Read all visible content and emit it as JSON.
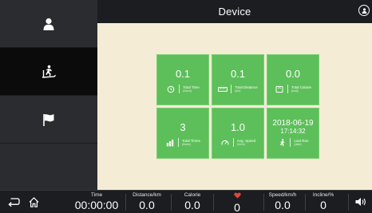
{
  "header": {
    "title": "Device"
  },
  "sidebar": {
    "items": [
      {
        "icon": "user-icon"
      },
      {
        "icon": "treadmill-runner-icon",
        "active": true
      },
      {
        "icon": "flag-icon"
      }
    ]
  },
  "cards": [
    {
      "value": "0.1",
      "icon": "clock-icon",
      "label": "Total Time",
      "unit": "(hours)"
    },
    {
      "value": "0.1",
      "icon": "ruler-icon",
      "label": "Total Distance",
      "unit": "(km)"
    },
    {
      "value": "0.0",
      "icon": "scale-icon",
      "label": "Total Calorie",
      "unit": "(kcal)"
    },
    {
      "value": "3",
      "icon": "bar-chart-icon",
      "label": "Total Times",
      "unit": "(times)"
    },
    {
      "value": "1.0",
      "icon": "speedometer-icon",
      "label": "Avg. Speed",
      "unit": "(km/h)"
    },
    {
      "value": "2018-06-19",
      "sub": "17:14:32",
      "icon": "runner-icon",
      "label": "Last Run",
      "unit": "(date)"
    }
  ],
  "bottom_bar": {
    "metrics": {
      "time": {
        "label": "Time",
        "value": "00:00:00"
      },
      "distance": {
        "label": "Distance/km",
        "value": "0.0"
      },
      "calorie": {
        "label": "Calorie",
        "value": "0.0"
      },
      "heart_rate": {
        "icon": "heart-icon",
        "value": "0"
      },
      "speed": {
        "label": "Speed/km/h",
        "value": "0.0"
      },
      "incline": {
        "label": "Incline/%",
        "value": "0"
      }
    }
  },
  "colors": {
    "card_green": "#5dbf5a",
    "background_beige": "#f4ecd4",
    "bar_dark": "#1b1d20",
    "heart_red": "#e0463b"
  }
}
